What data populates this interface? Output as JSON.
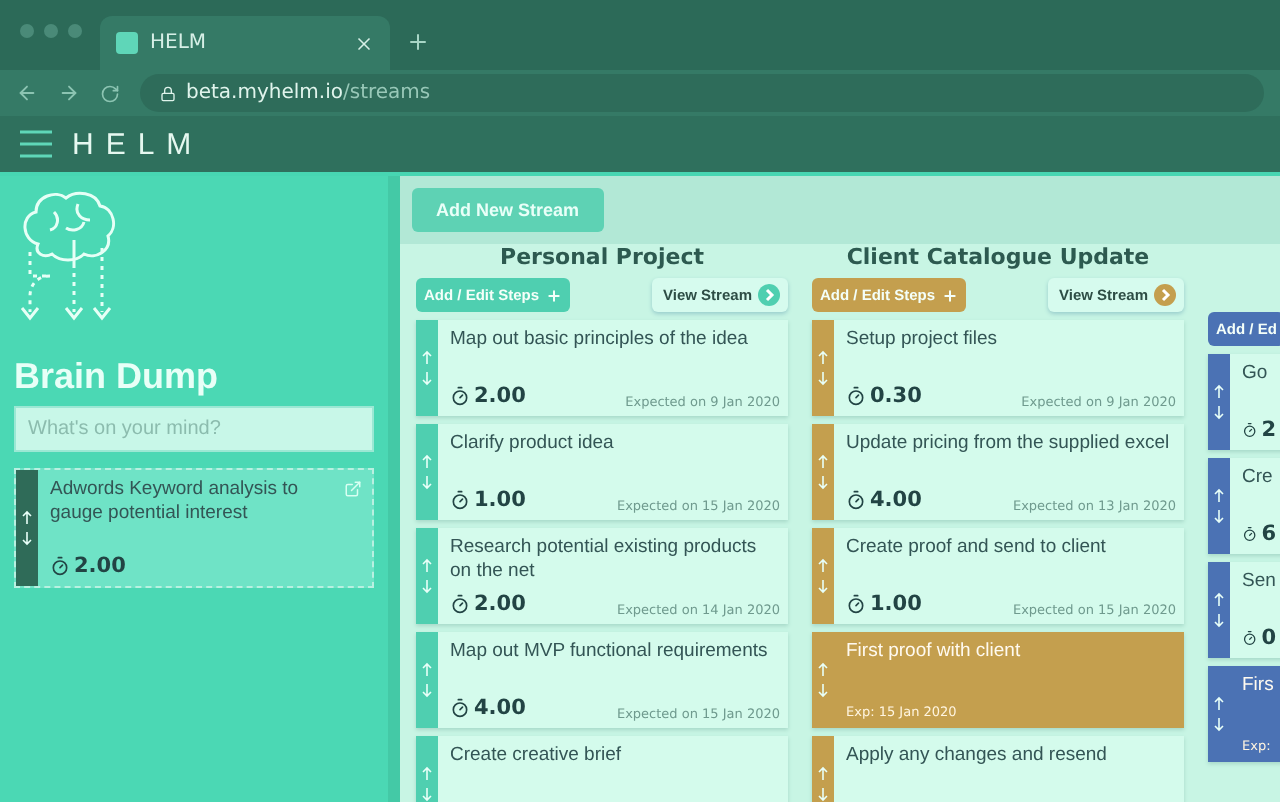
{
  "browser": {
    "tab_title": "HELM",
    "url_host": "beta.myhelm.io",
    "url_path": "/streams"
  },
  "app": {
    "logo": "HELM"
  },
  "sidebar": {
    "title": "Brain Dump",
    "placeholder": "What's on your mind?",
    "items": [
      {
        "text": "Adwords Keyword analysis to gauge potential interest",
        "time": "2.00"
      }
    ]
  },
  "toolbar": {
    "button": "Add New Stream"
  },
  "streams": [
    {
      "title": "Personal Project",
      "color": "#4fcfb0",
      "add_label": "Add / Edit Steps",
      "view_label": "View Stream",
      "steps": [
        {
          "kind": "task",
          "text": "Map out basic principles of the idea",
          "time": "2.00",
          "expected": "Expected on 9 Jan 2020"
        },
        {
          "kind": "task",
          "text": "Clarify product idea",
          "time": "1.00",
          "expected": "Expected on 15 Jan 2020"
        },
        {
          "kind": "task",
          "text": "Research potential existing products on the net",
          "time": "2.00",
          "expected": "Expected on 14 Jan 2020"
        },
        {
          "kind": "task",
          "text": "Map out MVP functional requirements",
          "time": "4.00",
          "expected": "Expected on 15 Jan 2020"
        },
        {
          "kind": "task",
          "text": "Create creative brief"
        }
      ]
    },
    {
      "title": "Client Catalogue Update",
      "color": "#c49f4e",
      "add_label": "Add / Edit Steps",
      "view_label": "View Stream",
      "steps": [
        {
          "kind": "task",
          "text": "Setup project files",
          "time": "0.30",
          "expected": "Expected on 9 Jan 2020"
        },
        {
          "kind": "task",
          "text": "Update pricing from the supplied excel",
          "time": "4.00",
          "expected": "Expected on 13 Jan 2020"
        },
        {
          "kind": "task",
          "text": "Create proof and send to client",
          "time": "1.00",
          "expected": "Expected on 15 Jan 2020"
        },
        {
          "kind": "milestone",
          "text": "First proof with client",
          "expected": "Exp: 15 Jan 2020"
        },
        {
          "kind": "task",
          "text": "Apply any changes and resend"
        }
      ]
    },
    {
      "color": "#4b72b4",
      "add_label": "Add / Ed",
      "steps": [
        {
          "kind": "task",
          "text": "Go",
          "time": "2"
        },
        {
          "kind": "task",
          "text": "Cre",
          "time": "6"
        },
        {
          "kind": "task",
          "text": "Sen",
          "time": "0"
        },
        {
          "kind": "milestone",
          "text": "Firs",
          "expected": "Exp:"
        }
      ]
    }
  ]
}
